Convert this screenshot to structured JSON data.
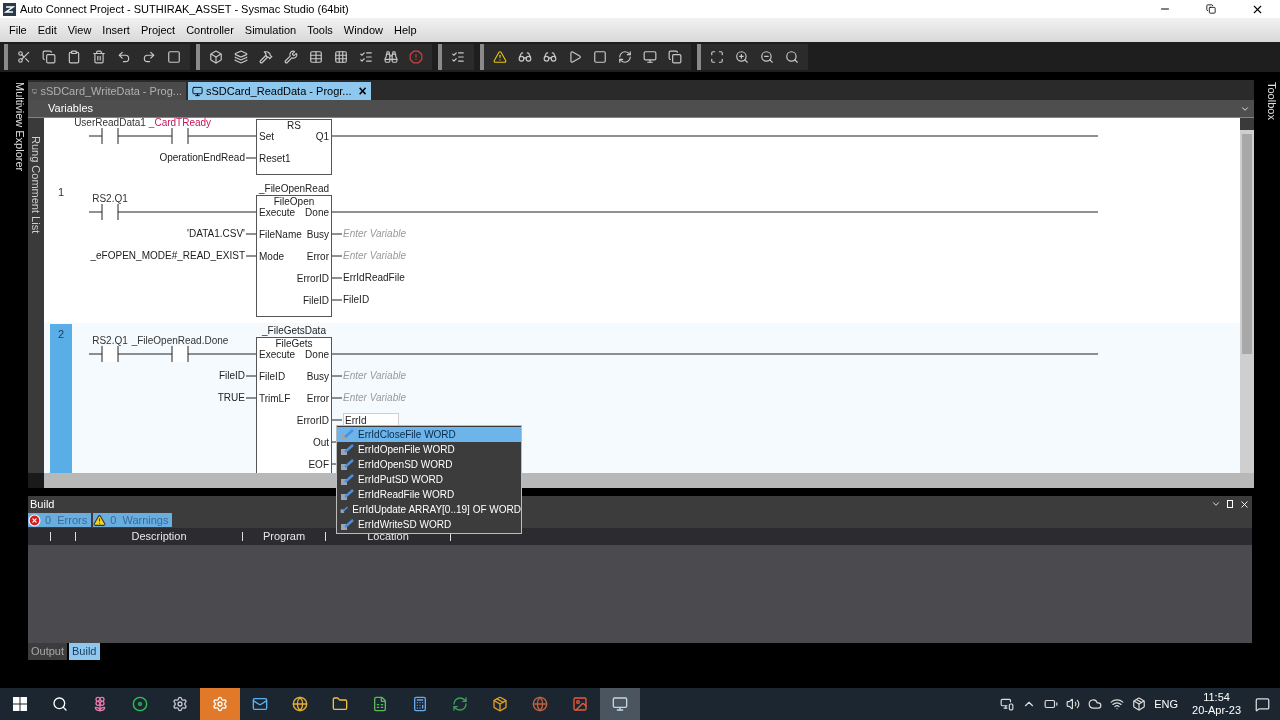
{
  "window": {
    "title": "Auto Connect Project - SUTHIRAK_ASSET - Sysmac Studio (64bit)"
  },
  "menu": [
    "File",
    "Edit",
    "View",
    "Insert",
    "Project",
    "Controller",
    "Simulation",
    "Tools",
    "Window",
    "Help"
  ],
  "side_panels": {
    "left": "Multiview Explorer",
    "right": "Toolbox"
  },
  "doc_tabs": [
    {
      "label": "sSDCard_WriteData - Prog...",
      "selected": false
    },
    {
      "label": "sSDCard_ReadData - Progr...",
      "selected": true
    }
  ],
  "doc_tab_close": "×",
  "variables_bar": "Variables",
  "rung_comment_list": "Rung Comment List",
  "rungs": [
    {
      "selected": false,
      "contacts": [
        {
          "label": "UserReadData1",
          "color": "#333333"
        },
        {
          "label": "_CardTReady",
          "color": "#c2185b"
        }
      ],
      "block": {
        "type": "RS",
        "inputs": [
          {
            "pin": "Set"
          },
          {
            "pin": "Reset1",
            "variable": "OperationEndRead"
          }
        ],
        "outputs": [
          {
            "pin": "Q1",
            "kind": "rail"
          }
        ]
      }
    },
    {
      "number": "1",
      "selected": false,
      "contacts": [
        {
          "label": "RS2.Q1",
          "color": "#333333"
        }
      ],
      "block": {
        "instance": "_FileOpenRead",
        "type": "FileOpen",
        "inputs": [
          {
            "pin": "Execute"
          },
          {
            "pin": "FileName",
            "variable": "'DATA1.CSV'"
          },
          {
            "pin": "Mode",
            "variable": "_eFOPEN_MODE#_READ_EXIST"
          }
        ],
        "outputs": [
          {
            "pin": "Done",
            "kind": "rail"
          },
          {
            "pin": "Busy",
            "kind": "placeholder",
            "text": "Enter Variable"
          },
          {
            "pin": "Error",
            "kind": "placeholder",
            "text": "Enter Variable"
          },
          {
            "pin": "ErrorID",
            "kind": "variable",
            "text": "ErrIdReadFile"
          },
          {
            "pin": "FileID",
            "kind": "variable",
            "text": "FileID"
          }
        ]
      }
    },
    {
      "number": "2",
      "selected": true,
      "contacts": [
        {
          "label": "RS2.Q1",
          "color": "#333333"
        },
        {
          "label": "_FileOpenRead.Done",
          "color": "#333333"
        }
      ],
      "block": {
        "instance": "_FileGetsData",
        "type": "FileGets",
        "inputs": [
          {
            "pin": "Execute"
          },
          {
            "pin": "FileID",
            "variable": "FileID"
          },
          {
            "pin": "TrimLF",
            "variable": "TRUE"
          }
        ],
        "outputs": [
          {
            "pin": "Done",
            "kind": "rail"
          },
          {
            "pin": "Busy",
            "kind": "placeholder",
            "text": "Enter Variable"
          },
          {
            "pin": "Error",
            "kind": "placeholder",
            "text": "Enter Variable"
          },
          {
            "pin": "ErrorID",
            "kind": "editing",
            "text": "ErrId"
          },
          {
            "pin": "Out",
            "kind": "stub"
          },
          {
            "pin": "EOF",
            "kind": "stub"
          }
        ]
      }
    }
  ],
  "autocomplete": [
    {
      "name": "ErrIdCloseFile",
      "type": "WORD",
      "selected": true
    },
    {
      "name": "ErrIdOpenFile",
      "type": "WORD",
      "selected": false
    },
    {
      "name": "ErrIdOpenSD",
      "type": "WORD",
      "selected": false
    },
    {
      "name": "ErrIdPutSD",
      "type": "WORD",
      "selected": false
    },
    {
      "name": "ErrIdReadFile",
      "type": "WORD",
      "selected": false
    },
    {
      "name": "ErrIdUpdate",
      "type": "ARRAY[0..19] OF WORD",
      "selected": false
    },
    {
      "name": "ErrIdWriteSD",
      "type": "WORD",
      "selected": false
    }
  ],
  "build": {
    "title": "Build",
    "filters": [
      {
        "kind": "error",
        "count": "0",
        "label": "Errors"
      },
      {
        "kind": "warning",
        "count": "0",
        "label": "Warnings"
      }
    ],
    "columns": [
      "Description",
      "Program",
      "Location"
    ],
    "tabs": [
      {
        "label": "Output",
        "selected": false
      },
      {
        "label": "Build",
        "selected": true
      }
    ]
  },
  "taskbar": {
    "language": "ENG",
    "time": "11:54",
    "date": "20-Apr-23"
  }
}
